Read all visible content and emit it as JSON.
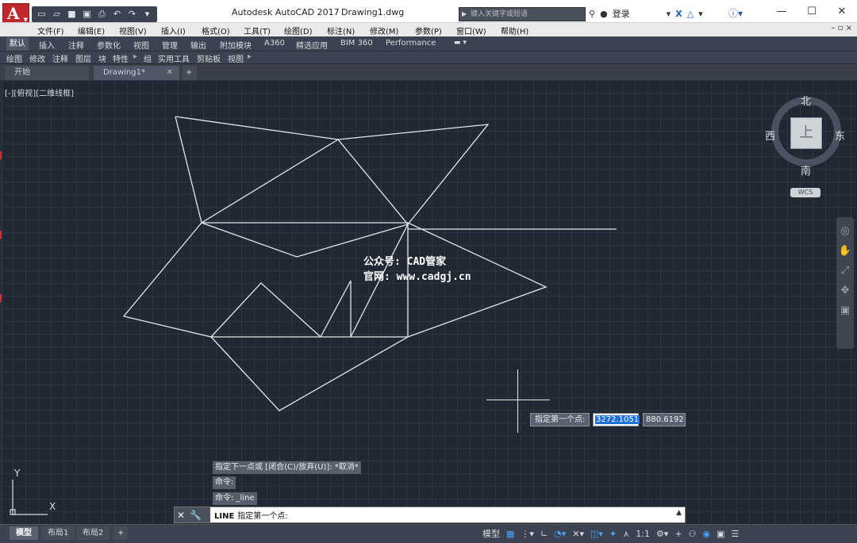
{
  "app": {
    "title": "Autodesk AutoCAD 2017",
    "document": "Drawing1.dwg",
    "app_button_letter": "A",
    "search_placeholder": "键入关键字或短语",
    "login_label": "登录"
  },
  "menu": {
    "items": [
      "文件(F)",
      "编辑(E)",
      "视图(V)",
      "插入(I)",
      "格式(O)",
      "工具(T)",
      "绘图(D)",
      "标注(N)",
      "修改(M)",
      "参数(P)",
      "窗口(W)",
      "帮助(H)"
    ]
  },
  "ribbon": {
    "tabs": [
      "默认",
      "插入",
      "注释",
      "参数化",
      "视图",
      "管理",
      "输出",
      "附加模块",
      "A360",
      "精选应用",
      "BIM 360",
      "Performance"
    ],
    "active_tab": "默认",
    "panels": [
      "绘图",
      "修改",
      "注释",
      "图层",
      "块",
      "特性",
      "组",
      "实用工具",
      "剪贴板",
      "视图"
    ]
  },
  "file_tabs": {
    "start": "开始",
    "drawing": "Drawing1*",
    "add": "+"
  },
  "viewport": {
    "label": "[-][俯视][二维线框]",
    "compass": {
      "north": "北",
      "south": "南",
      "east": "东",
      "west": "西",
      "face": "上"
    },
    "wcs": "WCS",
    "watermark_line1": "公众号: CAD管家",
    "watermark_line2": "官网: www.cadgj.cn",
    "ucs_x": "X",
    "ucs_y": "Y"
  },
  "dynamic_input": {
    "prompt": "指定第一个点:",
    "x_value": "3272.1051",
    "y_value": "880.6192"
  },
  "command_history": [
    "指定下一点或 [闭合(C)/放弃(U)]: *取消*",
    "命令:",
    "命令: _line"
  ],
  "command_line": {
    "command": "LINE",
    "prompt": "指定第一个点:"
  },
  "layout_tabs": [
    "模型",
    "布局1",
    "布局2"
  ],
  "status_bar": {
    "model_label": "模型",
    "scale": "1:1"
  },
  "colors": {
    "canvas": "#212833",
    "line": "#e6e6e6",
    "ribbon": "#3b4250",
    "app_button": "#c0272d"
  }
}
